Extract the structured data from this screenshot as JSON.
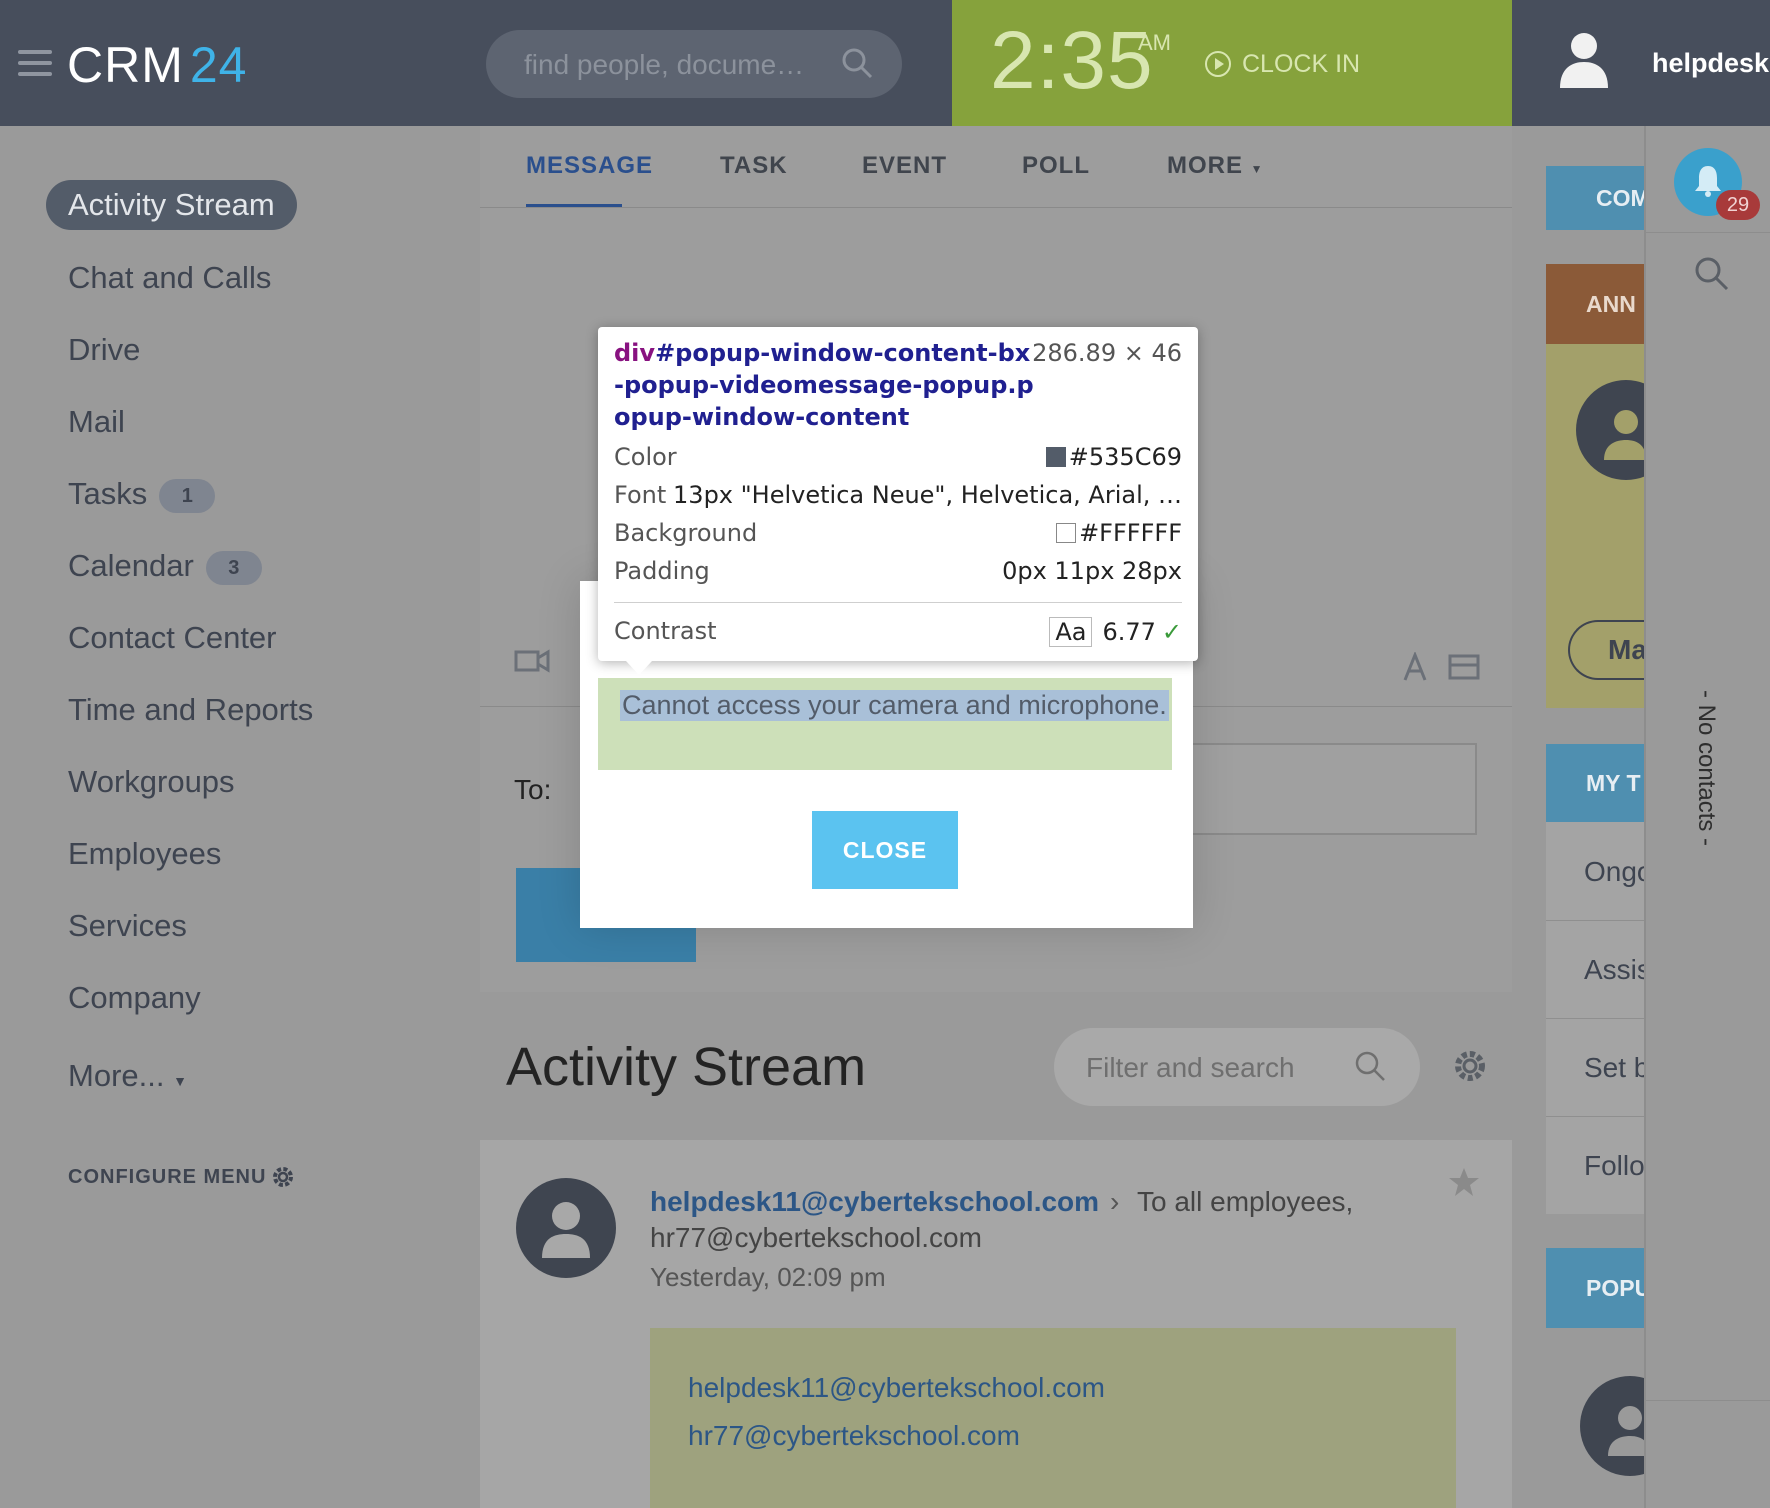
{
  "header": {
    "logo_text": "CRM",
    "logo_num": "24",
    "search_placeholder": "find people, docume…",
    "time": "2:35",
    "ampm": "AM",
    "clock_in": "CLOCK IN",
    "username": "helpdesk"
  },
  "sidebar": {
    "active": "Activity Stream",
    "items": [
      {
        "label": "Chat and Calls"
      },
      {
        "label": "Drive"
      },
      {
        "label": "Mail"
      },
      {
        "label": "Tasks",
        "badge": "1"
      },
      {
        "label": "Calendar",
        "badge": "3"
      },
      {
        "label": "Contact Center"
      },
      {
        "label": "Time and Reports"
      },
      {
        "label": "Workgroups"
      },
      {
        "label": "Employees"
      },
      {
        "label": "Services"
      },
      {
        "label": "Company"
      },
      {
        "label": "More..."
      }
    ],
    "configure": "CONFIGURE MENU"
  },
  "composer": {
    "tabs": [
      "MESSAGE",
      "TASK",
      "EVENT",
      "POLL",
      "MORE"
    ],
    "to_label": "To:"
  },
  "stream": {
    "title": "Activity Stream",
    "filter_placeholder": "Filter and search",
    "post": {
      "author": "helpdesk11@cybertekschool.com",
      "to": "To all employees,",
      "to2": "hr77@cybertekschool.com",
      "time": "Yesterday, 02:09 pm",
      "links": [
        "helpdesk11@cybertekschool.com",
        "hr77@cybertekschool.com"
      ]
    }
  },
  "right_column": {
    "tab1": "COM",
    "tab2": "ANN",
    "btn": "Ma",
    "tab3": "MY T",
    "list": [
      "Ongo",
      "Assis",
      "Set b",
      "Follo"
    ],
    "tab4": "POPU"
  },
  "far_right": {
    "notif_count": "29",
    "no_contacts": "- No contacts -"
  },
  "popup": {
    "message": "Cannot access your camera and microphone.",
    "close": "CLOSE"
  },
  "tooltip": {
    "tag": "div",
    "selector": "#popup-window-content-bx-popup-videomessage-popup.popup-window-content",
    "size": "286.89 × 46",
    "color_label": "Color",
    "color_value": "#535C69",
    "font_label": "Font",
    "font_value": "13px \"Helvetica Neue\", Helvetica, Arial, …",
    "bg_label": "Background",
    "bg_value": "#FFFFFF",
    "padding_label": "Padding",
    "padding_value": "0px 11px 28px",
    "contrast_label": "Contrast",
    "contrast_aa": "Aa",
    "contrast_value": "6.77"
  },
  "colors": {
    "header_bg": "#474e5c",
    "clock_bg": "#86a23c",
    "accent": "#3fb3e8",
    "close_btn": "#5bc3f0"
  }
}
